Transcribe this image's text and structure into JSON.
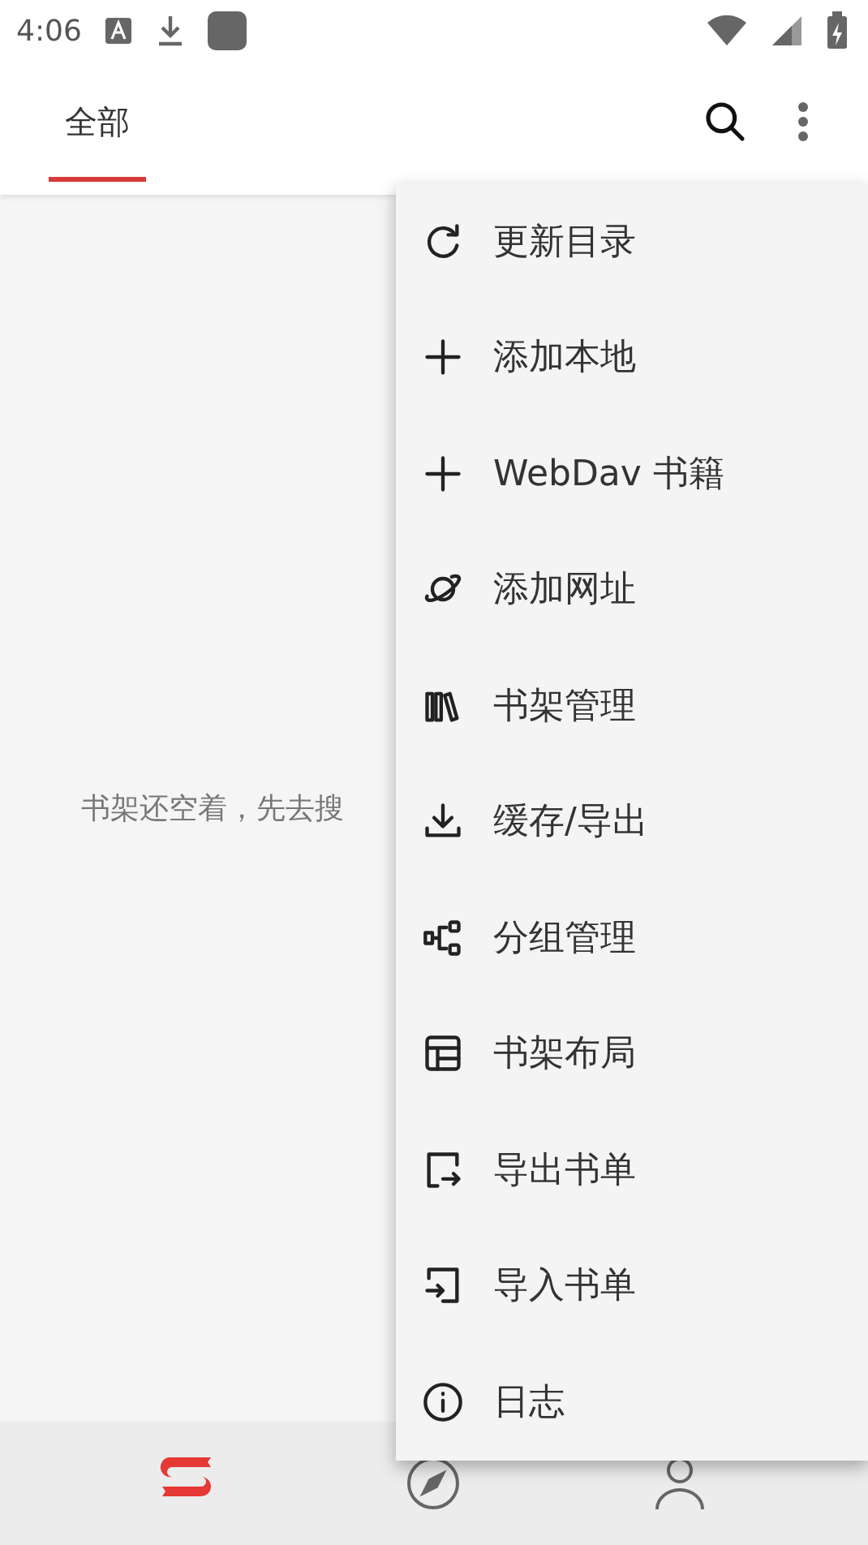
{
  "status_bar": {
    "time": "4:06"
  },
  "tabs": [
    {
      "label": "全部",
      "selected": true
    }
  ],
  "empty_message": "书架还空着，先去搜",
  "menu": [
    {
      "kind": "refresh",
      "label": "更新目录"
    },
    {
      "kind": "plus",
      "label": "添加本地"
    },
    {
      "kind": "plus",
      "label": "WebDav 书籍"
    },
    {
      "kind": "planet",
      "label": "添加网址"
    },
    {
      "kind": "books",
      "label": "书架管理"
    },
    {
      "kind": "download",
      "label": "缓存/导出"
    },
    {
      "kind": "group",
      "label": "分组管理"
    },
    {
      "kind": "layout",
      "label": "书架布局"
    },
    {
      "kind": "export",
      "label": "导出书单"
    },
    {
      "kind": "import",
      "label": "导入书单"
    },
    {
      "kind": "info",
      "label": "日志"
    }
  ],
  "bottom_nav": [
    {
      "kind": "bookshelf",
      "selected": true
    },
    {
      "kind": "explore",
      "selected": false
    },
    {
      "kind": "profile",
      "selected": false
    }
  ]
}
